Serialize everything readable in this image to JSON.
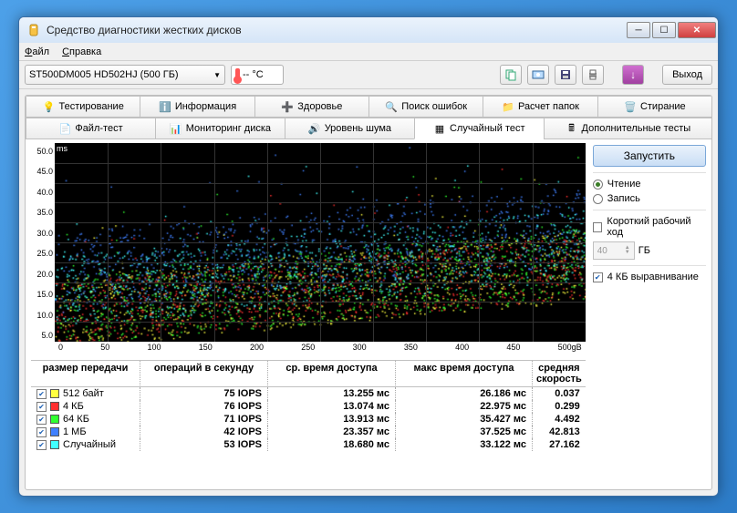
{
  "window": {
    "title": "Средство диагностики жестких дисков"
  },
  "menu": {
    "file": "Файл",
    "help": "Справка"
  },
  "toolbar": {
    "drive": "ST500DM005 HD502HJ    (500 ГБ)",
    "temp": "-- °C",
    "exit": "Выход"
  },
  "tabs_top": {
    "testing": "Тестирование",
    "info": "Информация",
    "health": "Здоровье",
    "errors": "Поиск ошибок",
    "folders": "Расчет папок",
    "erase": "Стирание"
  },
  "tabs_bottom": {
    "file_test": "Файл-тест",
    "monitoring": "Мониторинг диска",
    "noise": "Уровень шума",
    "random": "Случайный тест",
    "extra": "Дополнительные тесты"
  },
  "sidebar": {
    "run": "Запустить",
    "read": "Чтение",
    "write": "Запись",
    "short_stroke": "Короткий рабочий ход",
    "size_value": "40",
    "size_unit": "ГБ",
    "align4k": "4 КБ выравнивание"
  },
  "chart": {
    "y_unit": "ms",
    "y_ticks": [
      "50.0",
      "45.0",
      "40.0",
      "35.0",
      "30.0",
      "25.0",
      "20.0",
      "15.0",
      "10.0",
      "5.0"
    ],
    "x_ticks": [
      "0",
      "50",
      "100",
      "150",
      "200",
      "250",
      "300",
      "350",
      "400",
      "450",
      "500gB"
    ]
  },
  "chart_data": {
    "type": "scatter",
    "title": "",
    "xlabel": "gB",
    "ylabel": "ms",
    "xlim": [
      0,
      500
    ],
    "ylim": [
      0,
      50
    ],
    "series": [
      {
        "name": "512 байт",
        "color": "#ffff40",
        "mean_ms": 13.255,
        "spread": 9,
        "iops": 75
      },
      {
        "name": "4 КБ",
        "color": "#ff3030",
        "mean_ms": 13.074,
        "spread": 8,
        "iops": 76
      },
      {
        "name": "64 КБ",
        "color": "#30ff30",
        "mean_ms": 13.913,
        "spread": 9,
        "iops": 71
      },
      {
        "name": "1 МБ",
        "color": "#4080ff",
        "mean_ms": 23.357,
        "spread": 10,
        "iops": 42
      },
      {
        "name": "Случайный",
        "color": "#40ffff",
        "mean_ms": 18.68,
        "spread": 9,
        "iops": 53
      }
    ]
  },
  "table": {
    "headers": {
      "size": "размер передачи",
      "iops": "операций в секунду",
      "avg": "ср. время доступа",
      "max": "макс время доступа",
      "speed": "средняя скорость"
    },
    "rows": [
      {
        "color": "#ffff40",
        "label": "512 байт",
        "iops": "75 IOPS",
        "avg": "13.255 мс",
        "max": "26.186 мс",
        "speed": "0.037"
      },
      {
        "color": "#ff3030",
        "label": "4 КБ",
        "iops": "76 IOPS",
        "avg": "13.074 мс",
        "max": "22.975 мс",
        "speed": "0.299"
      },
      {
        "color": "#30ff30",
        "label": "64 КБ",
        "iops": "71 IOPS",
        "avg": "13.913 мс",
        "max": "35.427 мс",
        "speed": "4.492"
      },
      {
        "color": "#4080ff",
        "label": "1 МБ",
        "iops": "42 IOPS",
        "avg": "23.357 мс",
        "max": "37.525 мс",
        "speed": "42.813"
      },
      {
        "color": "#40ffff",
        "label": "Случайный",
        "iops": "53 IOPS",
        "avg": "18.680 мс",
        "max": "33.122 мс",
        "speed": "27.162"
      }
    ]
  }
}
